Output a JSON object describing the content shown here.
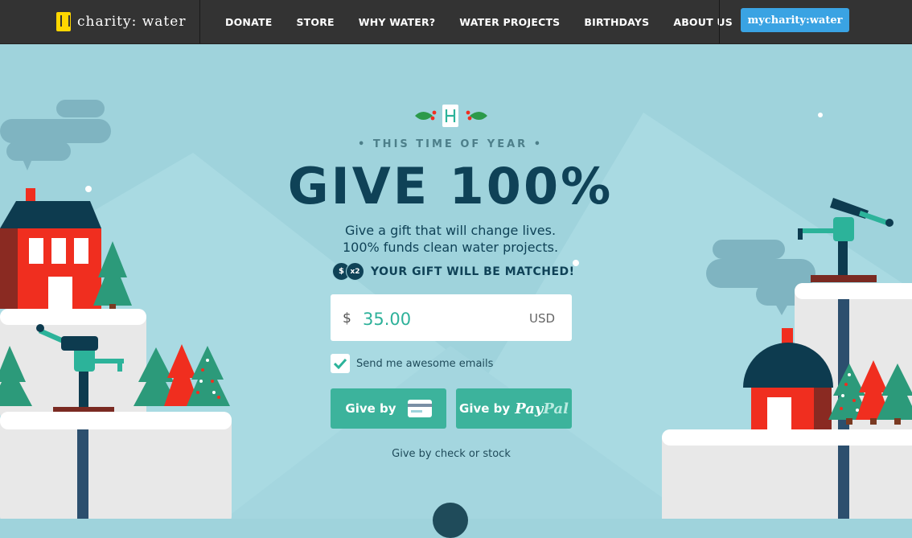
{
  "nav": {
    "brand": "charity: water",
    "links": [
      "DONATE",
      "STORE",
      "WHY WATER?",
      "WATER PROJECTS",
      "BIRTHDAYS",
      "ABOUT US"
    ],
    "cta": "mycharity:water"
  },
  "hero": {
    "eyebrow": "• THIS TIME OF YEAR •",
    "headline": "GIVE 100%",
    "sub_line1": "Give a gift that will change lives.",
    "sub_line2": "100% funds clean water projects.",
    "match_coin_a": "$",
    "match_coin_b": "x2",
    "match_text": "YOUR GIFT WILL BE MATCHED!"
  },
  "donate": {
    "currency_symbol": "$",
    "amount": "35.00",
    "currency_code": "USD",
    "email_opt_label": "Send me awesome emails",
    "email_opt_checked": true,
    "give_card_label": "Give by",
    "give_paypal_label": "Give by",
    "paypal_a": "Pay",
    "paypal_b": "Pal",
    "check_link": "Give by check or stock"
  },
  "colors": {
    "sky": "#9fd3dc",
    "navy": "#0f4257",
    "teal": "#3cb39c",
    "red": "#f02e1f",
    "nav_bg": "#333333",
    "cta_blue": "#3aa3e3"
  }
}
